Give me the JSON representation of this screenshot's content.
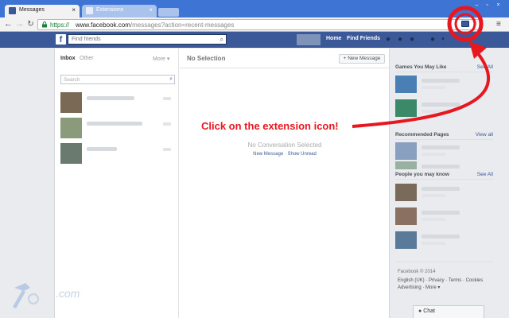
{
  "browser": {
    "tabs": [
      {
        "label": "Messages",
        "active": true,
        "favicon": "facebook-icon"
      },
      {
        "label": "Extensions",
        "active": false,
        "favicon": "puzzle-icon"
      }
    ],
    "url": {
      "scheme": "https://",
      "host": "www.facebook.com",
      "path": "/messages?action=recent-messages"
    },
    "icons": {
      "back": "back-arrow-icon",
      "forward": "forward-arrow-icon",
      "reload": "reload-icon",
      "lock": "lock-icon",
      "extension": "extension-icon",
      "star": "star-icon",
      "menu": "menu-icon"
    }
  },
  "fb_header": {
    "search_placeholder": "Find friends",
    "home_label": "Home",
    "find_friends_label": "Find Friends",
    "brand_color": "#3b5998"
  },
  "inbox": {
    "tab_inbox": "Inbox",
    "tab_other": "Other",
    "more_label": "More ▾",
    "search_placeholder": "Search",
    "conversations": [
      {
        "thumb_color": "#7a6a55"
      },
      {
        "thumb_color": "#8a9a7a"
      },
      {
        "thumb_color": "#6a7a6e"
      }
    ]
  },
  "conversation_pane": {
    "title": "No Selection",
    "new_message_label": "+ New Message",
    "empty_text": "No Conversation Selected",
    "link_new_message": "New Message",
    "link_separator": " · ",
    "link_show_unread": "Show Unread"
  },
  "annotation": {
    "text": "Click on the extension icon!",
    "color": "#e8171f"
  },
  "sidebar": {
    "games_title": "Games You May Like",
    "games_link": "See All",
    "games_colors": [
      "#4a7fb5",
      "#3a8a6a"
    ],
    "pages_title": "Recommended Pages",
    "pages_link": "View all",
    "pages_colors": [
      "#8aa0c0",
      "#9ab0a0"
    ],
    "people_title": "People you may know",
    "people_link": "See All",
    "people_colors": [
      "#7a6a5a",
      "#8a7060",
      "#5a7a9a"
    ],
    "footer_copyright": "Facebook © 2014",
    "footer_links": "English (UK) · Privacy · Terms · Cookies",
    "footer_links2": "Advertising · More ▾"
  },
  "chat": {
    "label": "Chat"
  },
  "watermark": {
    "text": ".com"
  }
}
